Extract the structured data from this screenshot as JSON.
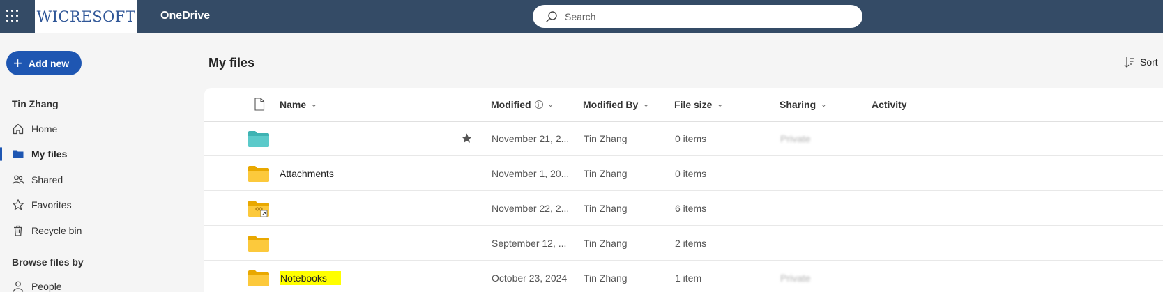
{
  "topbar": {
    "brand": "WICRESOFT",
    "app_name": "OneDrive",
    "search_placeholder": "Search"
  },
  "sidebar": {
    "add_new": "Add new",
    "user_name": "Tin Zhang",
    "items": [
      {
        "label": "Home",
        "icon": "home-icon"
      },
      {
        "label": "My files",
        "icon": "folder-icon",
        "active": true
      },
      {
        "label": "Shared",
        "icon": "people-icon"
      },
      {
        "label": "Favorites",
        "icon": "star-icon"
      },
      {
        "label": "Recycle bin",
        "icon": "trash-icon"
      }
    ],
    "browse_heading": "Browse files by",
    "browse_items": [
      {
        "label": "People",
        "icon": "person-icon"
      }
    ]
  },
  "main": {
    "title": "My files",
    "sort_label": "Sort",
    "columns": {
      "name": "Name",
      "modified": "Modified",
      "modified_by": "Modified By",
      "file_size": "File size",
      "sharing": "Sharing",
      "activity": "Activity"
    },
    "rows": [
      {
        "name": "",
        "modified": "November 21, 2...",
        "modified_by": "Tin Zhang",
        "size": "0 items",
        "sharing": "Private",
        "folder_color": "#5bc8c8",
        "favorite": true
      },
      {
        "name": "Attachments",
        "modified": "November 1, 20...",
        "modified_by": "Tin Zhang",
        "size": "0 items",
        "sharing": "",
        "folder_color": "#f8c53a"
      },
      {
        "name": "",
        "modified": "November 22, 2...",
        "modified_by": "Tin Zhang",
        "size": "6 items",
        "sharing": "",
        "folder_color": "#f8c53a",
        "shared": true
      },
      {
        "name": "",
        "modified": "September 12, ...",
        "modified_by": "Tin Zhang",
        "size": "2 items",
        "sharing": "",
        "folder_color": "#f8c53a"
      },
      {
        "name": "Notebooks",
        "modified": "October 23, 2024",
        "modified_by": "Tin Zhang",
        "size": "1 item",
        "sharing": "Private",
        "folder_color": "#f8c53a",
        "highlighted": true
      }
    ]
  },
  "colors": {
    "topbar": "#344b66",
    "accent": "#1e56b2",
    "highlight": "#ffff00"
  }
}
